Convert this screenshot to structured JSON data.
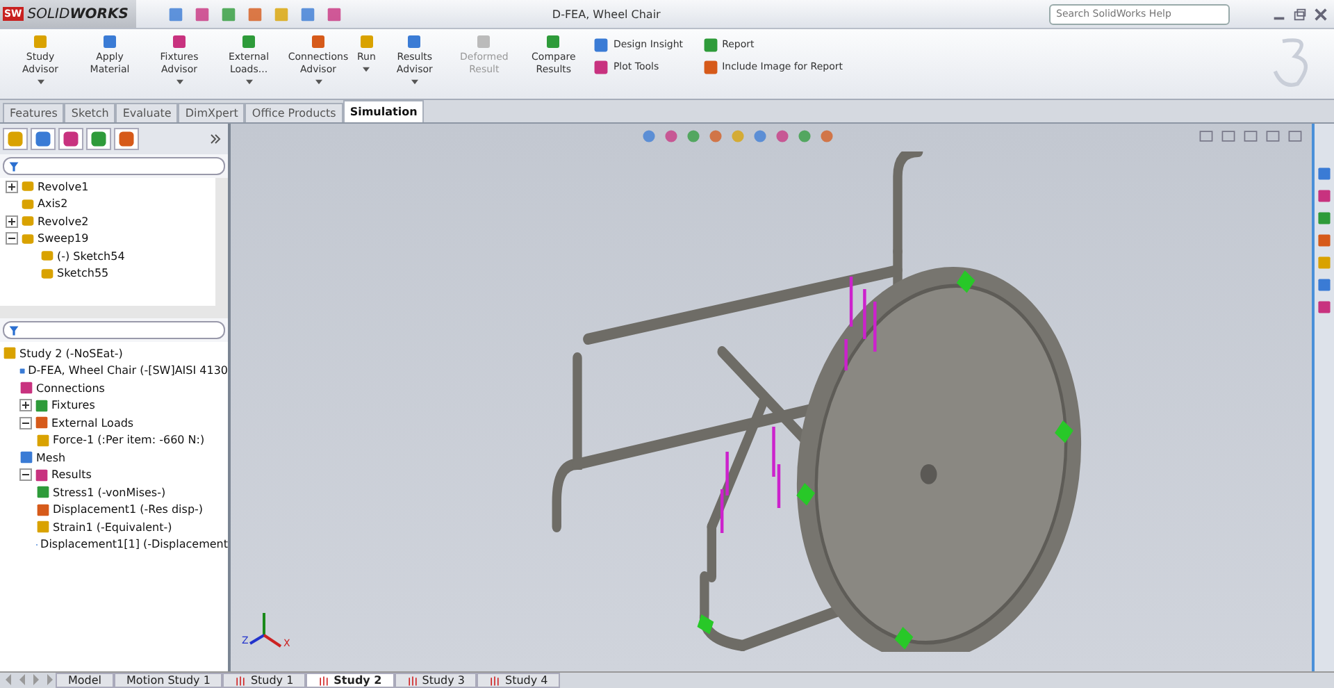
{
  "titlebar": {
    "logo_badge": "SW",
    "logo": "SOLID**WORKS**",
    "title": "D-FEA, Wheel Chair",
    "search": {
      "placeholder": "Search SolidWorks Help"
    }
  },
  "ribbon": {
    "large_buttons": [
      {
        "label": "Study Advisor",
        "disabled": false,
        "dropdown": true
      },
      {
        "label": "Apply Material",
        "disabled": false,
        "dropdown": false
      },
      {
        "label": "Fixtures Advisor",
        "disabled": false,
        "dropdown": true
      },
      {
        "label": "External Loads...",
        "disabled": false,
        "dropdown": true
      },
      {
        "label": "Connections Advisor",
        "disabled": false,
        "dropdown": true
      },
      {
        "label": "Run",
        "disabled": false,
        "dropdown": true
      },
      {
        "label": "Results Advisor",
        "disabled": false,
        "dropdown": true
      },
      {
        "label": "Deformed Result",
        "disabled": true,
        "dropdown": false
      },
      {
        "label": "Compare Results",
        "disabled": false,
        "dropdown": false
      }
    ],
    "small_buttons": [
      {
        "label": "Design Insight"
      },
      {
        "label": "Plot Tools"
      },
      {
        "label": "Report"
      },
      {
        "label": "Include Image for Report"
      }
    ]
  },
  "tabs": [
    {
      "label": "Features",
      "selected": false
    },
    {
      "label": "Sketch",
      "selected": false
    },
    {
      "label": "Evaluate",
      "selected": false
    },
    {
      "label": "DimXpert",
      "selected": false
    },
    {
      "label": "Office Products",
      "selected": false
    },
    {
      "label": "Simulation",
      "selected": true
    }
  ],
  "feature_tree": [
    {
      "label": "Revolve1",
      "expanded": false
    },
    {
      "label": "Axis2"
    },
    {
      "label": "Revolve2",
      "expanded": false
    },
    {
      "label": "Sweep19",
      "expanded": true,
      "children": [
        {
          "label": "(-) Sketch54"
        },
        {
          "label": "Sketch55"
        }
      ]
    }
  ],
  "study_tree": [
    {
      "label": "Study 2 (-NoSEat-)",
      "children": [
        {
          "label": "D-FEA, Wheel Chair (-[SW]AISI 4130"
        },
        {
          "label": "Connections"
        },
        {
          "label": "Fixtures",
          "expanded": false
        },
        {
          "label": "External Loads",
          "expanded": true,
          "children": [
            {
              "label": "Force-1 (:Per item: -660 N:)"
            }
          ]
        },
        {
          "label": "Mesh"
        },
        {
          "label": "Results",
          "expanded": true,
          "children": [
            {
              "label": "Stress1 (-vonMises-)"
            },
            {
              "label": "Displacement1 (-Res disp-)"
            },
            {
              "label": "Strain1 (-Equivalent-)"
            },
            {
              "label": "Displacement1[1] (-Displacement"
            }
          ]
        }
      ]
    }
  ],
  "triad": {
    "z": "Z",
    "x": "X"
  },
  "bottom_tabs": [
    {
      "label": "Model",
      "selected": false,
      "study": false
    },
    {
      "label": "Motion Study 1",
      "selected": false,
      "study": false
    },
    {
      "label": "Study 1",
      "selected": false,
      "study": true
    },
    {
      "label": "Study 2",
      "selected": true,
      "study": true
    },
    {
      "label": "Study 3",
      "selected": false,
      "study": true
    },
    {
      "label": "Study 4",
      "selected": false,
      "study": true
    }
  ]
}
